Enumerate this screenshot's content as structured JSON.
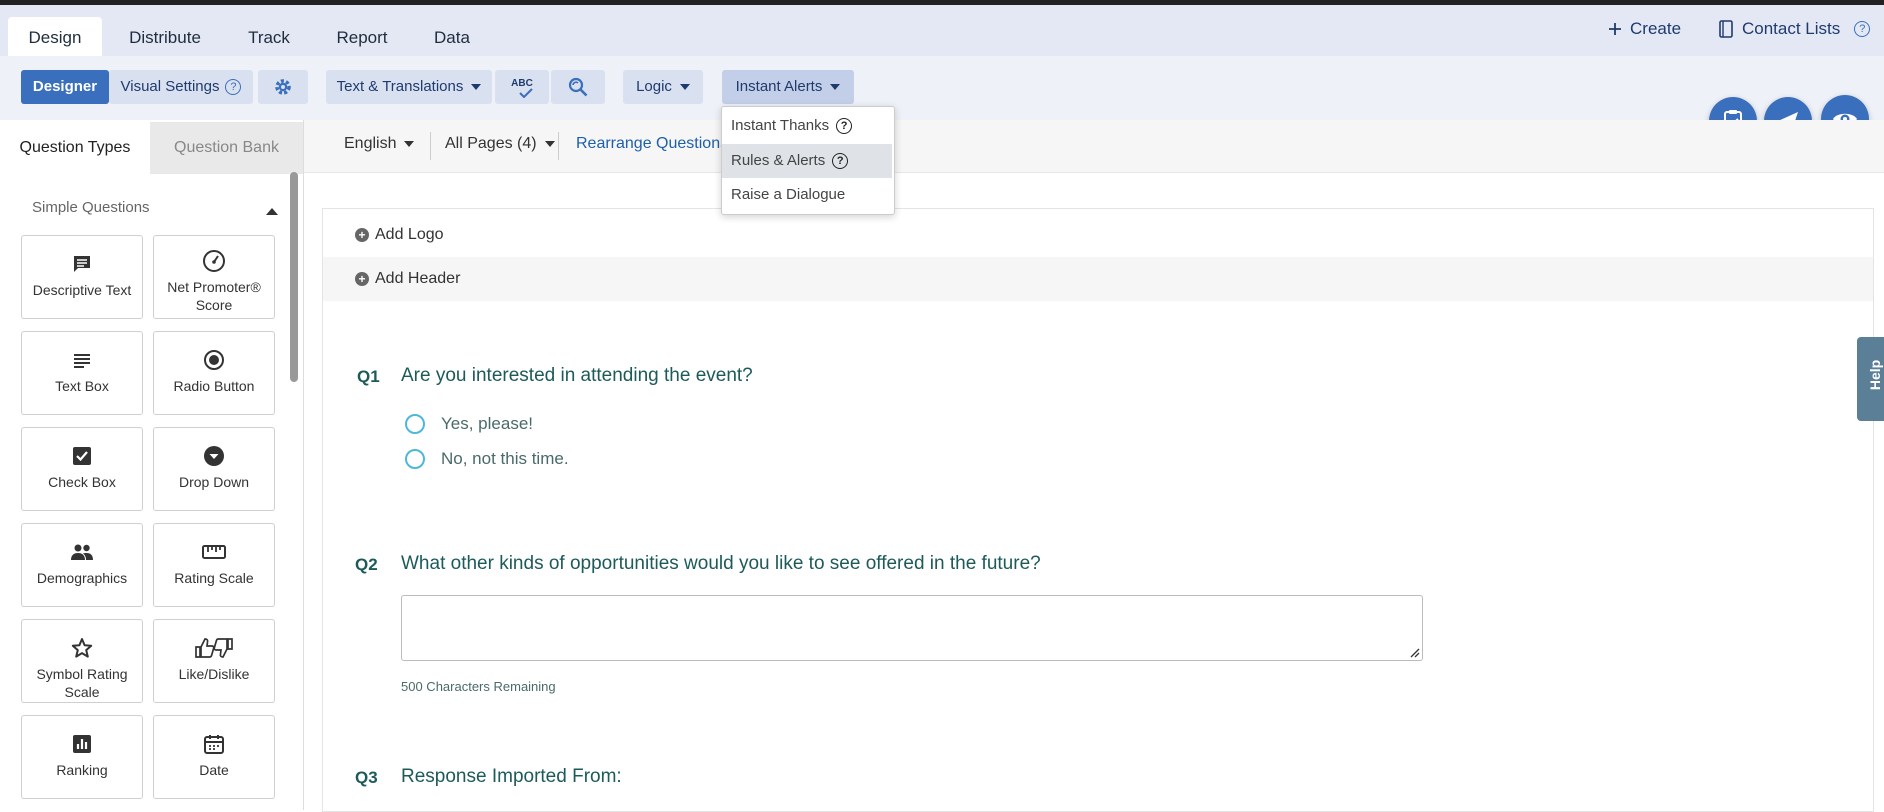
{
  "nav": {
    "tabs": [
      "Design",
      "Distribute",
      "Track",
      "Report",
      "Data"
    ],
    "create_label": "Create",
    "contact_lists_label": "Contact Lists"
  },
  "toolbar": {
    "designer_label": "Designer",
    "visual_settings_label": "Visual Settings",
    "text_translations_label": "Text & Translations",
    "spellcheck_label": "ABC",
    "logic_label": "Logic",
    "instant_alerts_label": "Instant Alerts"
  },
  "instant_alerts_menu": {
    "items": [
      "Instant Thanks",
      "Rules & Alerts",
      "Raise a Dialogue"
    ]
  },
  "sidebar": {
    "tabs": [
      "Question Types",
      "Question Bank"
    ],
    "section_title": "Simple Questions",
    "question_types": [
      {
        "label": "Descriptive Text",
        "icon": "comment-icon"
      },
      {
        "label": "Net Promoter® Score",
        "icon": "gauge-icon"
      },
      {
        "label": "Text Box",
        "icon": "lines-icon"
      },
      {
        "label": "Radio Button",
        "icon": "radio-icon"
      },
      {
        "label": "Check Box",
        "icon": "checkbox-icon"
      },
      {
        "label": "Drop Down",
        "icon": "dropdown-icon"
      },
      {
        "label": "Demographics",
        "icon": "people-icon"
      },
      {
        "label": "Rating Scale",
        "icon": "ruler-icon"
      },
      {
        "label": "Symbol Rating Scale",
        "icon": "star-icon"
      },
      {
        "label": "Like/Dislike",
        "icon": "thumbs-icon"
      },
      {
        "label": "Ranking",
        "icon": "chart-icon"
      },
      {
        "label": "Date",
        "icon": "calendar-icon"
      }
    ]
  },
  "content_bar": {
    "language": "English",
    "pages": "All Pages (4)",
    "rearrange": "Rearrange Questions"
  },
  "survey": {
    "add_logo": "Add Logo",
    "add_header": "Add Header",
    "questions": [
      {
        "num": "Q1",
        "text": "Are you interested in attending the event?",
        "options": [
          "Yes, please!",
          "No, not this time."
        ]
      },
      {
        "num": "Q2",
        "text": "What other kinds of opportunities would you like to see offered in the future?",
        "chars_remaining": "500 Characters Remaining"
      },
      {
        "num": "Q3",
        "text": "Response Imported From:"
      }
    ]
  },
  "help_tab": "Help"
}
